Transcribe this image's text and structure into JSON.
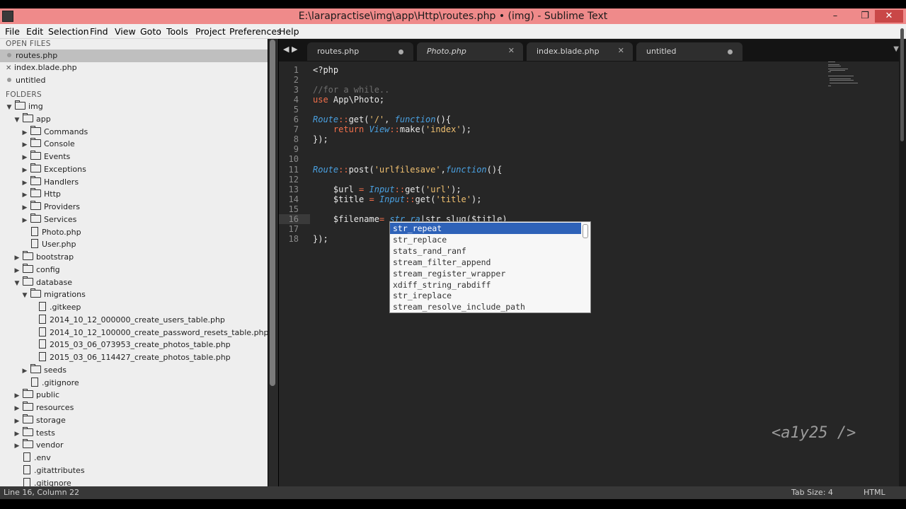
{
  "window": {
    "title": "E:\\larapractise\\img\\app\\Http\\routes.php • (img) - Sublime Text",
    "minimize": "–",
    "restore": "❐",
    "close": "✕"
  },
  "menu": [
    "File",
    "Edit",
    "Selection",
    "Find",
    "View",
    "Goto",
    "Tools",
    "Project",
    "Preferences",
    "Help"
  ],
  "sidebar": {
    "open_files_header": "OPEN FILES",
    "open_files": [
      "routes.php",
      "index.blade.php",
      "untitled"
    ],
    "folders_header": "FOLDERS",
    "tree": [
      {
        "label": "img",
        "kind": "folder",
        "open": true,
        "depth": 0
      },
      {
        "label": "app",
        "kind": "folder",
        "open": true,
        "depth": 1
      },
      {
        "label": "Commands",
        "kind": "folder",
        "open": false,
        "depth": 2
      },
      {
        "label": "Console",
        "kind": "folder",
        "open": false,
        "depth": 2
      },
      {
        "label": "Events",
        "kind": "folder",
        "open": false,
        "depth": 2
      },
      {
        "label": "Exceptions",
        "kind": "folder",
        "open": false,
        "depth": 2
      },
      {
        "label": "Handlers",
        "kind": "folder",
        "open": false,
        "depth": 2
      },
      {
        "label": "Http",
        "kind": "folder",
        "open": false,
        "depth": 2
      },
      {
        "label": "Providers",
        "kind": "folder",
        "open": false,
        "depth": 2
      },
      {
        "label": "Services",
        "kind": "folder",
        "open": false,
        "depth": 2
      },
      {
        "label": "Photo.php",
        "kind": "file",
        "depth": 2
      },
      {
        "label": "User.php",
        "kind": "file",
        "depth": 2
      },
      {
        "label": "bootstrap",
        "kind": "folder",
        "open": false,
        "depth": 1
      },
      {
        "label": "config",
        "kind": "folder",
        "open": false,
        "depth": 1
      },
      {
        "label": "database",
        "kind": "folder",
        "open": true,
        "depth": 1
      },
      {
        "label": "migrations",
        "kind": "folder",
        "open": true,
        "depth": 2
      },
      {
        "label": ".gitkeep",
        "kind": "file",
        "depth": 3
      },
      {
        "label": "2014_10_12_000000_create_users_table.php",
        "kind": "file",
        "depth": 3
      },
      {
        "label": "2014_10_12_100000_create_password_resets_table.php",
        "kind": "file",
        "depth": 3
      },
      {
        "label": "2015_03_06_073953_create_photos_table.php",
        "kind": "file",
        "depth": 3
      },
      {
        "label": "2015_03_06_114427_create_photos_table.php",
        "kind": "file",
        "depth": 3
      },
      {
        "label": "seeds",
        "kind": "folder",
        "open": false,
        "depth": 2
      },
      {
        "label": ".gitignore",
        "kind": "file",
        "depth": 2
      },
      {
        "label": "public",
        "kind": "folder",
        "open": false,
        "depth": 1
      },
      {
        "label": "resources",
        "kind": "folder",
        "open": false,
        "depth": 1
      },
      {
        "label": "storage",
        "kind": "folder",
        "open": false,
        "depth": 1
      },
      {
        "label": "tests",
        "kind": "folder",
        "open": false,
        "depth": 1
      },
      {
        "label": "vendor",
        "kind": "folder",
        "open": false,
        "depth": 1
      },
      {
        "label": ".env",
        "kind": "file",
        "depth": 1
      },
      {
        "label": ".gitattributes",
        "kind": "file",
        "depth": 1
      },
      {
        "label": ".gitignore",
        "kind": "file",
        "depth": 1
      }
    ]
  },
  "tabs": [
    {
      "label": "routes.php",
      "marker": "dot",
      "italic": false
    },
    {
      "label": "Photo.php",
      "marker": "close",
      "italic": true
    },
    {
      "label": "index.blade.php",
      "marker": "close",
      "italic": false
    },
    {
      "label": "untitled",
      "marker": "dot",
      "italic": false
    }
  ],
  "editor": {
    "line_numbers": [
      "1",
      "2",
      "3",
      "4",
      "5",
      "6",
      "7",
      "8",
      "9",
      "10",
      "11",
      "12",
      "13",
      "14",
      "15",
      "16",
      "17",
      "18"
    ],
    "current_line": 16,
    "lines": [
      [
        [
          "punc",
          "<?php"
        ]
      ],
      [],
      [
        [
          "cm",
          "//for a while.."
        ]
      ],
      [
        [
          "kw",
          "use"
        ],
        [
          "punc",
          " App\\Photo;"
        ]
      ],
      [],
      [
        [
          "ty",
          "Route"
        ],
        [
          "op",
          "::"
        ],
        [
          "punc",
          "get("
        ],
        [
          "str",
          "'/'"
        ],
        [
          "punc",
          ", "
        ],
        [
          "ty",
          "function"
        ],
        [
          "punc",
          "(){"
        ]
      ],
      [
        [
          "punc",
          "    "
        ],
        [
          "kw",
          "return"
        ],
        [
          "punc",
          " "
        ],
        [
          "ty",
          "View"
        ],
        [
          "op",
          "::"
        ],
        [
          "punc",
          "make("
        ],
        [
          "str",
          "'index'"
        ],
        [
          "punc",
          ");"
        ]
      ],
      [
        [
          "punc",
          "});"
        ]
      ],
      [],
      [],
      [
        [
          "ty",
          "Route"
        ],
        [
          "op",
          "::"
        ],
        [
          "punc",
          "post("
        ],
        [
          "str",
          "'urlfilesave'"
        ],
        [
          "punc",
          ","
        ],
        [
          "ty",
          "function"
        ],
        [
          "punc",
          "(){"
        ]
      ],
      [],
      [
        [
          "punc",
          "    $url "
        ],
        [
          "op",
          "="
        ],
        [
          "punc",
          " "
        ],
        [
          "ty",
          "Input"
        ],
        [
          "op",
          "::"
        ],
        [
          "punc",
          "get("
        ],
        [
          "str",
          "'url'"
        ],
        [
          "punc",
          ");"
        ]
      ],
      [
        [
          "punc",
          "    $title "
        ],
        [
          "op",
          "="
        ],
        [
          "punc",
          " "
        ],
        [
          "ty",
          "Input"
        ],
        [
          "op",
          "::"
        ],
        [
          "punc",
          "get("
        ],
        [
          "str",
          "'title'"
        ],
        [
          "punc",
          ");"
        ]
      ],
      [],
      [
        [
          "punc",
          "    $filename"
        ],
        [
          "op",
          "="
        ],
        [
          "punc",
          " "
        ],
        [
          "ty",
          "str_ra"
        ],
        [
          "punc",
          "|str_slug($title)"
        ]
      ],
      [],
      [
        [
          "punc",
          "});"
        ]
      ]
    ]
  },
  "autocomplete": {
    "items": [
      "str_repeat",
      "str_replace",
      "stats_rand_ranf",
      "stream_filter_append",
      "stream_register_wrapper",
      "xdiff_string_rabdiff",
      "str_ireplace",
      "stream_resolve_include_path"
    ],
    "selected_index": 0
  },
  "watermark": "<a1y25 />",
  "status": {
    "position": "Line 16, Column 22",
    "tab_size": "Tab Size: 4",
    "syntax": "HTML"
  },
  "colors": {
    "title_bar": "#ef8a8a",
    "editor_bg": "#262626",
    "keyword": "#f26f4b",
    "type": "#4aa0e0",
    "string": "#f0c070",
    "autocomplete_selection": "#2e62b8"
  }
}
